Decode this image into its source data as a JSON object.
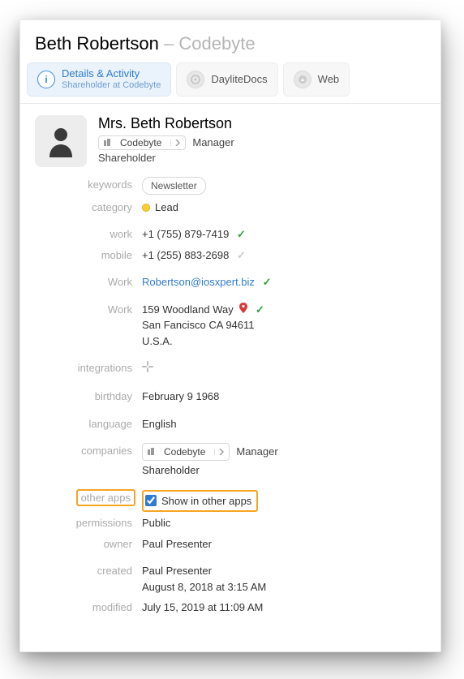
{
  "header": {
    "name": "Beth Robertson",
    "dash": "–",
    "company": "Codebyte"
  },
  "tabs": {
    "details": {
      "title": "Details & Activity",
      "sub": "Shareholder at Codebyte"
    },
    "docs": {
      "title": "DayliteDocs"
    },
    "web": {
      "title": "Web"
    }
  },
  "profile": {
    "name": "Mrs. Beth Robertson",
    "company": "Codebyte",
    "role": "Manager",
    "shareholder": "Shareholder"
  },
  "labels": {
    "keywords": "keywords",
    "category": "category",
    "work_phone": "work",
    "mobile": "mobile",
    "work_email": "Work",
    "work_addr": "Work",
    "integrations": "integrations",
    "birthday": "birthday",
    "language": "language",
    "companies": "companies",
    "other_apps": "other apps",
    "permissions": "permissions",
    "owner": "owner",
    "created": "created",
    "modified": "modified"
  },
  "values": {
    "keywords_pill": "Newsletter",
    "category": "Lead",
    "work_phone": "+1 (755) 879-7419",
    "mobile": "+1 (255) 883-2698",
    "email": "Robertson@iosxpert.biz",
    "addr1": "159 Woodland Way",
    "addr2": "San Fancisco CA 94611",
    "addr3": "U.S.A.",
    "birthday": "February  9  1968",
    "language": "English",
    "company_chip": "Codebyte",
    "company_role": "Manager",
    "company_shareholder": "Shareholder",
    "other_apps_label": "Show in other apps",
    "permissions": "Public",
    "owner": "Paul Presenter",
    "created_by": "Paul Presenter",
    "created_at": "August 8, 2018 at 3:15 AM",
    "modified_at": "July 15, 2019 at 11:09 AM"
  }
}
